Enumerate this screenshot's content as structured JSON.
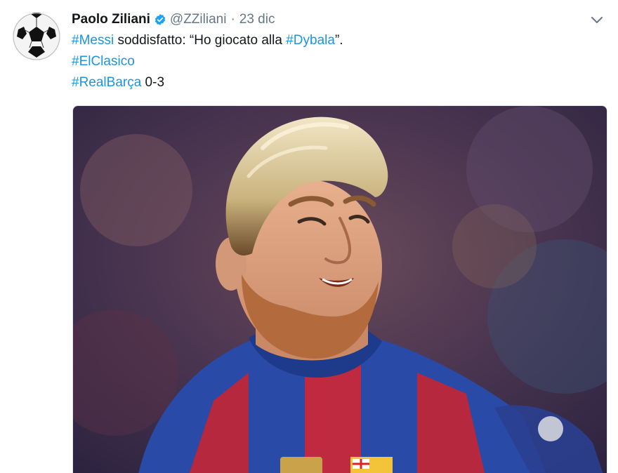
{
  "author": {
    "name": "Paolo Ziliani",
    "handle": "@ZZiliani",
    "separator": "·",
    "date": "23 dic",
    "avatar_icon": "soccer-ball-icon",
    "verified_icon": "verified-badge-icon"
  },
  "tweet": {
    "hashtag_messi": "#Messi",
    "text_1": " soddisfatto: “Ho giocato alla ",
    "hashtag_dybala": "#Dybala",
    "text_2": "”.",
    "hashtag_elclasico": "#ElClasico",
    "hashtag_realbarca": "#RealBarça",
    "score": " 0-3"
  },
  "menu": {
    "caret_icon": "chevron-down-icon"
  },
  "colors": {
    "link": "#1b95e0",
    "text": "#14171a",
    "secondary": "#657786",
    "verified": "#1da1f2"
  }
}
